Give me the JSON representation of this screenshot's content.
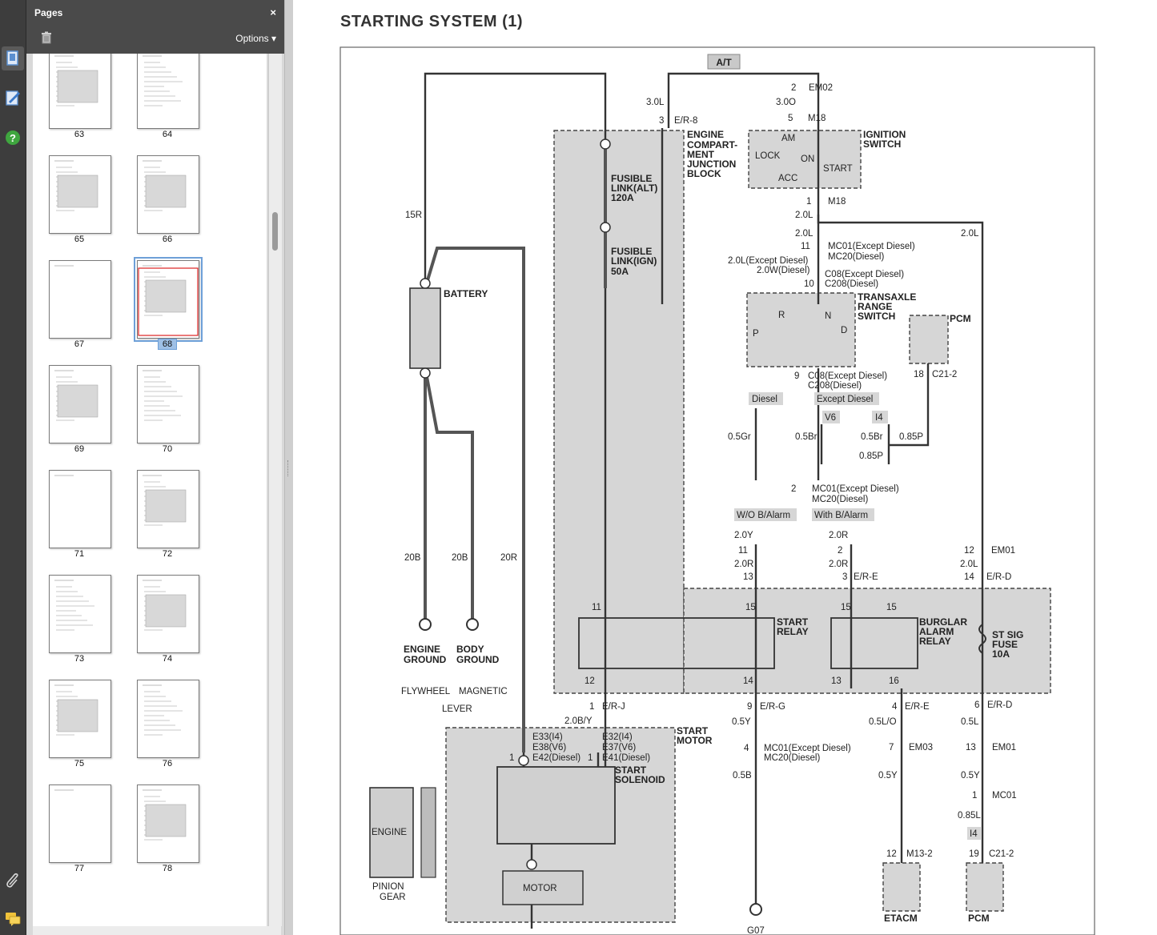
{
  "panel": {
    "title": "Pages",
    "close": "×",
    "options": "Options ▾",
    "thumbnails": [
      {
        "label": "63"
      },
      {
        "label": "64"
      },
      {
        "label": "65"
      },
      {
        "label": "66"
      },
      {
        "label": "67"
      },
      {
        "label": "68"
      },
      {
        "label": "69"
      },
      {
        "label": "70"
      },
      {
        "label": "71"
      },
      {
        "label": "72"
      },
      {
        "label": "73"
      },
      {
        "label": "74"
      },
      {
        "label": "75"
      },
      {
        "label": "76"
      },
      {
        "label": "77"
      },
      {
        "label": "78"
      }
    ],
    "selected_page": "68"
  },
  "rail": {
    "icons": [
      "page-thumbnails-icon",
      "signature-icon",
      "help-icon",
      "attachment-icon",
      "comments-icon"
    ]
  },
  "document": {
    "title": "STARTING SYSTEM (1)",
    "labels": {
      "at": "A/T",
      "em02_pin": "2",
      "em02": "EM02",
      "w_30l_a": "3.0L",
      "w_30o": "3.0O",
      "m18_top_pin": "5",
      "m18_top": "M18",
      "er8_pin": "3",
      "er8": "E/R-8",
      "ecjb1": "ENGINE",
      "ecjb2": "COMPART-",
      "ecjb3": "MENT",
      "ecjb4": "JUNCTION",
      "ecjb5": "BLOCK",
      "ign1": "IGNITION",
      "ign2": "SWITCH",
      "ign_am": "AM",
      "ign_lock": "LOCK",
      "ign_on": "ON",
      "ign_start": "START",
      "ign_acc": "ACC",
      "fl_alt1": "FUSIBLE",
      "fl_alt2": "LINK(ALT)",
      "fl_alt3": "120A",
      "fl_ign1": "FUSIBLE",
      "fl_ign2": "LINK(IGN)",
      "fl_ign3": "50A",
      "m18_b_pin": "1",
      "m18_b": "M18",
      "w_20l_1": "2.0L",
      "w_20l_2": "2.0L",
      "w_20l_right": "2.0L",
      "w_15r": "15R",
      "mc01_pin": "11",
      "mc01_a": "MC01(Except Diesel)",
      "mc20_a": "MC20(Diesel)",
      "w_ex_diesel": "2.0L(Except Diesel)",
      "w_diesel": "2.0W(Diesel)",
      "c08_pin": "10",
      "c08_a": "C08(Except Diesel)",
      "c208_a": "C208(Diesel)",
      "battery": "BATTERY",
      "trs1": "TRANSAXLE",
      "trs2": "RANGE",
      "trs3": "SWITCH",
      "trs_p": "P",
      "trs_r": "R",
      "trs_n": "N",
      "trs_d": "D",
      "pcm_top": "PCM",
      "c08b_pin": "9",
      "c08_b": "C08(Except Diesel)",
      "c208_b": "C208(Diesel)",
      "c21_pin": "18",
      "c21": "C21-2",
      "diesel": "Diesel",
      "except_diesel": "Except Diesel",
      "v6": "V6",
      "i4": "I4",
      "w_05gr": "0.5Gr",
      "w_05br_1": "0.5Br",
      "w_05br_2": "0.5Br",
      "w_085p_1": "0.85P",
      "w_085p_2": "0.85P",
      "mc01b_pin": "2",
      "mc01_b": "MC01(Except Diesel)",
      "mc20_b": "MC20(Diesel)",
      "wo_alarm": "W/O B/Alarm",
      "with_alarm": "With B/Alarm",
      "w_20y": "2.0Y",
      "w_20r_1": "2.0R",
      "w_20r_2": "2.0R",
      "w_20r_3": "2.0R",
      "w_20l_3": "2.0L",
      "p11": "11",
      "p2": "2",
      "p12": "12",
      "em01": "EM01",
      "p13": "13",
      "p3": "3",
      "ere": "E/R-E",
      "p14": "14",
      "erd": "E/R-D",
      "w_20b_1": "20B",
      "w_20b_2": "20B",
      "w_20r": "20R",
      "relay11": "11",
      "relay15a": "15",
      "relay15b": "15",
      "relay15c": "15",
      "sr1": "START",
      "sr2": "RELAY",
      "bar1": "BURGLAR",
      "bar2": "ALARM",
      "bar3": "RELAY",
      "ssf1": "ST SIG",
      "ssf2": "FUSE",
      "ssf3": "10A",
      "relay12": "12",
      "relay14": "14",
      "relay13": "13",
      "relay16": "16",
      "eng_gnd1": "ENGINE",
      "eng_gnd2": "GROUND",
      "body_gnd1": "BODY",
      "body_gnd2": "GROUND",
      "flywheel": "FLYWHEEL",
      "magnetic": "MAGNETIC",
      "lever": "LEVER",
      "erj_pin": "1",
      "erj": "E/R-J",
      "erg_pin": "9",
      "erg": "E/R-G",
      "ere2_pin": "4",
      "ere2": "E/R-E",
      "erd2_pin": "6",
      "erd2": "E/R-D",
      "w_20by": "2.0B/Y",
      "w_05y_1": "0.5Y",
      "w_05lo": "0.5L/O",
      "w_05l": "0.5L",
      "sm1": "START",
      "sm2": "MOTOR",
      "e33": "E33(I4)",
      "e38": "E38(V6)",
      "e42": "E42(Diesel)",
      "e32": "E32(I4)",
      "e37": "E37(V6)",
      "e41": "E41(Diesel)",
      "pin1a": "1",
      "pin1b": "1",
      "ss1": "START",
      "ss2": "SOLENOID",
      "mc01c_pin": "4",
      "mc01_c": "MC01(Except Diesel)",
      "mc20_c": "MC20(Diesel)",
      "em03_pin": "7",
      "em03": "EM03",
      "em01b_pin": "13",
      "em01_b": "EM01",
      "w_05b": "0.5B",
      "w_05y_2": "0.5Y",
      "w_05y_3": "0.5Y",
      "mc01d_pin": "1",
      "mc01_d": "MC01",
      "w_085l": "0.85L",
      "i4_b": "I4",
      "engine": "ENGINE",
      "pinion1": "PINION",
      "pinion2": "GEAR",
      "motor": "MOTOR",
      "m132_pin": "12",
      "m132": "M13-2",
      "c212_pin": "19",
      "c212": "C21-2",
      "etacm": "ETACM",
      "pcm_bottom": "PCM",
      "g07": "G07"
    }
  }
}
